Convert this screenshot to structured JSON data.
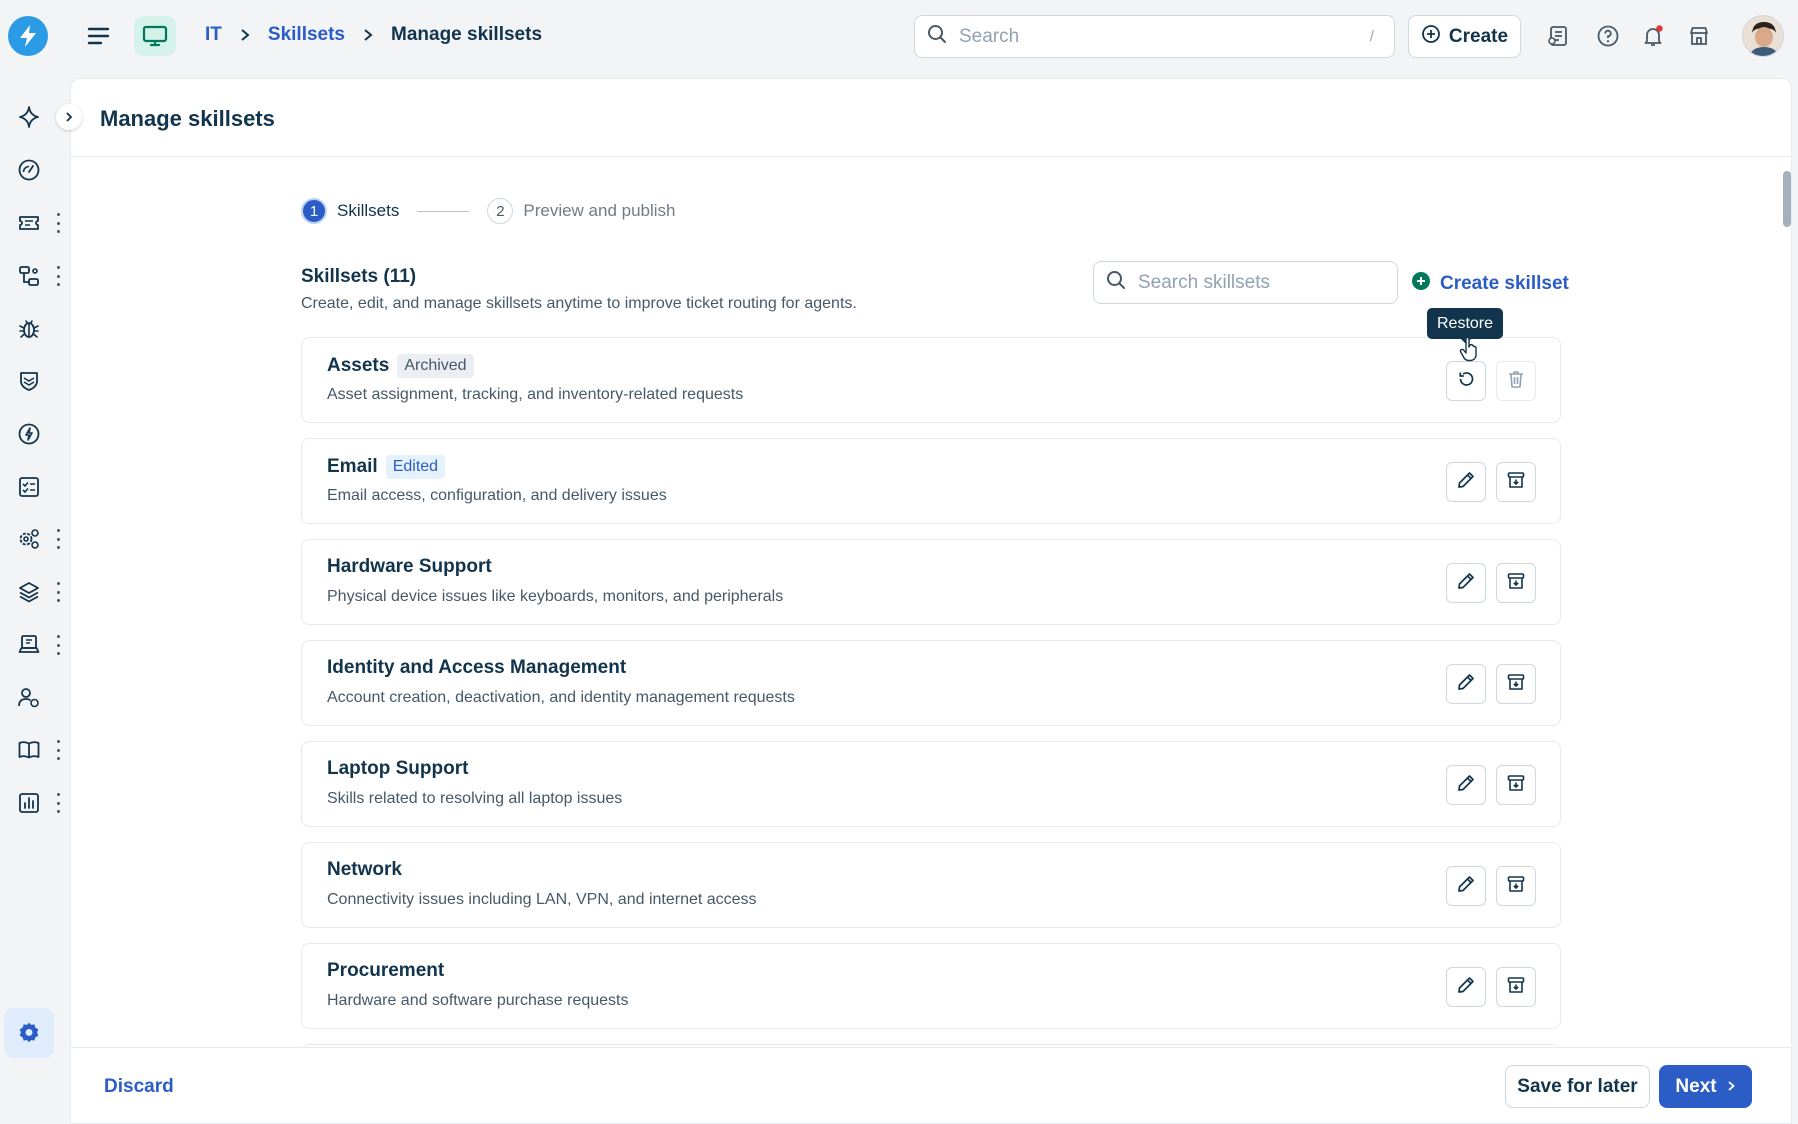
{
  "header": {
    "breadcrumb": [
      "IT",
      "Skillsets",
      "Manage skillsets"
    ],
    "search_placeholder": "Search",
    "search_shortcut": "/",
    "create_label": "Create"
  },
  "page": {
    "title": "Manage skillsets"
  },
  "stepper": {
    "steps": [
      {
        "number": "1",
        "label": "Skillsets",
        "active": true
      },
      {
        "number": "2",
        "label": "Preview and publish",
        "active": false
      }
    ]
  },
  "skillsets": {
    "title": "Skillsets (11)",
    "subtitle": "Create, edit, and manage skillsets anytime to improve ticket routing for agents.",
    "search_placeholder": "Search skillsets",
    "create_label": "Create skillset",
    "tooltip": "Restore",
    "items": [
      {
        "name": "Assets",
        "badge": "Archived",
        "desc": "Asset assignment, tracking, and inventory-related requests"
      },
      {
        "name": "Email",
        "badge": "Edited",
        "desc": "Email access, configuration, and delivery issues"
      },
      {
        "name": "Hardware Support",
        "badge": "",
        "desc": "Physical device issues like keyboards, monitors, and peripherals"
      },
      {
        "name": "Identity and Access Management",
        "badge": "",
        "desc": "Account creation, deactivation, and identity management requests"
      },
      {
        "name": "Laptop Support",
        "badge": "",
        "desc": "Skills related to resolving all laptop issues"
      },
      {
        "name": "Network",
        "badge": "",
        "desc": "Connectivity issues including LAN, VPN, and internet access"
      },
      {
        "name": "Procurement",
        "badge": "",
        "desc": "Hardware and software purchase requests"
      }
    ]
  },
  "footer": {
    "discard_label": "Discard",
    "save_label": "Save for later",
    "next_label": "Next"
  },
  "colors": {
    "primary": "#2c5cc5",
    "text": "#12344d",
    "logo": "#2c9be5",
    "success": "#00795b",
    "notification": "#e43538"
  }
}
